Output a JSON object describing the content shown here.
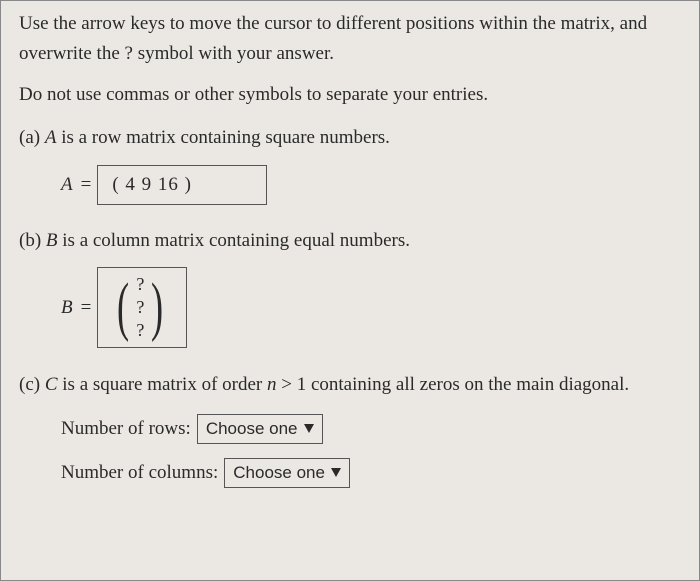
{
  "intro_line1": "Use the arrow keys to move the cursor to different positions within the matrix, and overwrite the ? symbol with your answer.",
  "intro_line2": "Do not use commas or other symbols to separate your entries.",
  "part_a": {
    "label": "(a)",
    "text_pre": "A",
    "text_post": " is a row matrix containing square numbers.",
    "lhs": "A",
    "eq": "=",
    "matrix": "( 4   9   16 )"
  },
  "part_b": {
    "label": "(b)",
    "text_pre": "B",
    "text_post": " is a column matrix containing equal numbers.",
    "lhs": "B",
    "eq": "=",
    "cells": [
      "?",
      "?",
      "?"
    ]
  },
  "part_c": {
    "label": "(c)",
    "text_pre": "C",
    "text_mid1": " is a square matrix of order ",
    "text_n": "n",
    "text_mid2": " > 1 containing all zeros on the main diagonal.",
    "rows_label": "Number of rows:",
    "cols_label": "Number of columns:",
    "dropdown_text": "Choose one"
  }
}
